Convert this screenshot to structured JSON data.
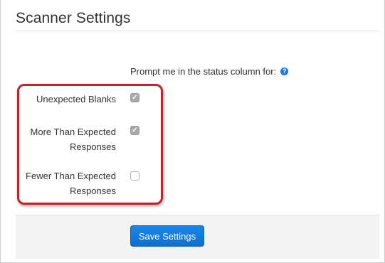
{
  "page": {
    "title": "Scanner Settings"
  },
  "prompt": {
    "label": "Prompt me in the status column for:",
    "help_icon": "question-circle-icon"
  },
  "options": [
    {
      "label_line1": "Unexpected Blanks",
      "label_line2": "",
      "checked": true
    },
    {
      "label_line1": "More Than Expected",
      "label_line2": "Responses",
      "checked": true
    },
    {
      "label_line1": "Fewer Than Expected",
      "label_line2": "Responses",
      "checked": false
    }
  ],
  "footer": {
    "save_label": "Save Settings"
  },
  "colors": {
    "accent": "#1a86e8",
    "highlight": "#c1232b",
    "checked_box": "#a9a9a9"
  }
}
